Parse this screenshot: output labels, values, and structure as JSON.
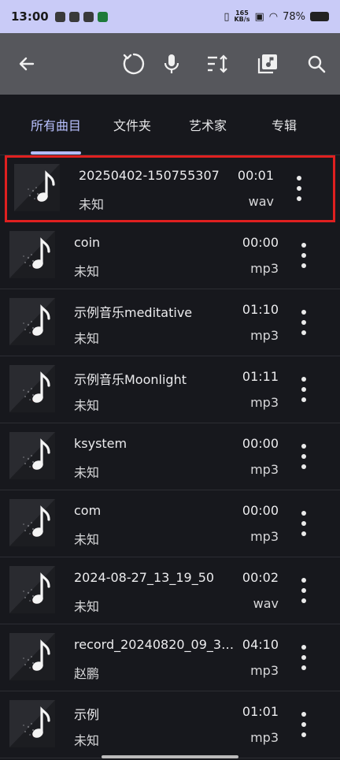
{
  "status": {
    "time": "13:00",
    "speed_top": "165",
    "speed_bottom": "KB/s",
    "battery": "78%"
  },
  "toolbar": {
    "back_icon": "arrow-left-icon",
    "refresh_icon": "refresh-icon",
    "mic_icon": "microphone-icon",
    "sort_icon": "sort-icon",
    "playlist_icon": "music-library-icon",
    "search_icon": "search-icon"
  },
  "tabs": [
    {
      "label": "所有曲目",
      "active": true
    },
    {
      "label": "文件夹",
      "active": false
    },
    {
      "label": "艺术家",
      "active": false
    },
    {
      "label": "专辑",
      "active": false
    }
  ],
  "tracks": [
    {
      "title": "20250402-150755307",
      "artist": "未知",
      "duration": "00:01",
      "format": "wav"
    },
    {
      "title": "coin",
      "artist": "未知",
      "duration": "00:00",
      "format": "mp3"
    },
    {
      "title": "示例音乐meditative",
      "artist": "未知",
      "duration": "01:10",
      "format": "mp3"
    },
    {
      "title": "示例音乐Moonlight",
      "artist": "未知",
      "duration": "01:11",
      "format": "mp3"
    },
    {
      "title": "ksystem",
      "artist": "未知",
      "duration": "00:00",
      "format": "mp3"
    },
    {
      "title": "com",
      "artist": "未知",
      "duration": "00:00",
      "format": "mp3"
    },
    {
      "title": "2024-08-27_13_19_50",
      "artist": "未知",
      "duration": "00:02",
      "format": "wav"
    },
    {
      "title": "record_20240820_09_38…",
      "artist": "赵鹏",
      "duration": "04:10",
      "format": "mp3"
    },
    {
      "title": "示例",
      "artist": "未知",
      "duration": "01:01",
      "format": "mp3"
    }
  ],
  "colors": {
    "accent": "#b3bbf8",
    "highlight_border": "#e02020",
    "toolbar_bg": "#56575c",
    "status_bg": "#c9cbf7"
  }
}
